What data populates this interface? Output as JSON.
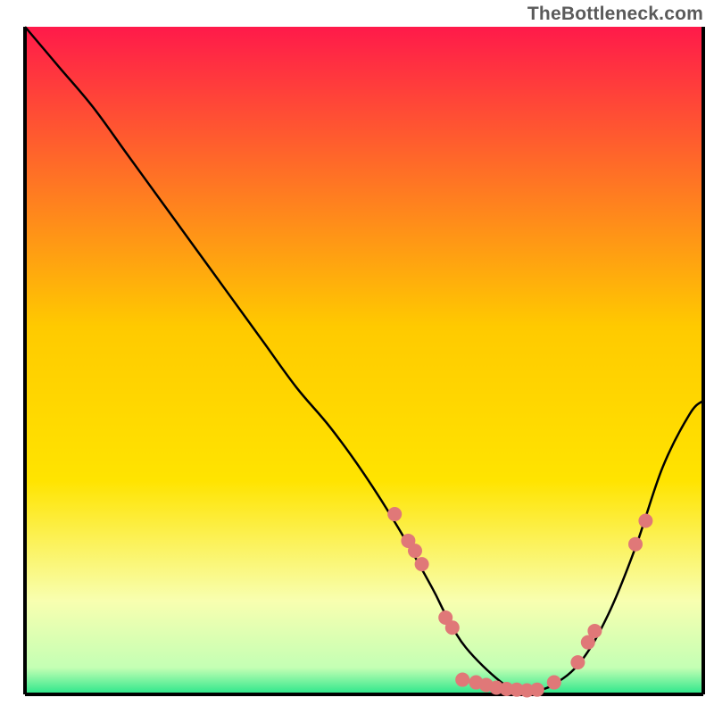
{
  "watermark": "TheBottleneck.com",
  "chart_data": {
    "type": "line",
    "title": "",
    "xlabel": "",
    "ylabel": "",
    "xlim": [
      0,
      100
    ],
    "ylim": [
      0,
      100
    ],
    "grid": false,
    "legend": false,
    "background_gradient_top": "#ff1a4a",
    "background_gradient_mid": "#ffe400",
    "background_gradient_low": "#f8ffb0",
    "background_gradient_bottom": "#29e68a",
    "series": [
      {
        "name": "curve",
        "color": "#000000",
        "x": [
          0,
          5,
          10,
          15,
          20,
          25,
          30,
          35,
          40,
          45,
          50,
          55,
          60,
          62,
          65,
          70,
          73,
          75,
          78,
          82,
          86,
          90,
          94,
          98,
          100
        ],
        "y": [
          100,
          94,
          88,
          81,
          74,
          67,
          60,
          53,
          46,
          40,
          33,
          25,
          16,
          12,
          7,
          2,
          0.5,
          0.5,
          1.5,
          5,
          12,
          22,
          34,
          42,
          44
        ]
      }
    ],
    "markers": [
      {
        "x": 54.5,
        "y": 27
      },
      {
        "x": 56.5,
        "y": 23
      },
      {
        "x": 57.5,
        "y": 21.5
      },
      {
        "x": 58.5,
        "y": 19.5
      },
      {
        "x": 62.0,
        "y": 11.5
      },
      {
        "x": 63.0,
        "y": 10
      },
      {
        "x": 64.5,
        "y": 2.2
      },
      {
        "x": 66.5,
        "y": 1.8
      },
      {
        "x": 68.0,
        "y": 1.4
      },
      {
        "x": 69.5,
        "y": 1.0
      },
      {
        "x": 71.0,
        "y": 0.8
      },
      {
        "x": 72.5,
        "y": 0.7
      },
      {
        "x": 74.0,
        "y": 0.6
      },
      {
        "x": 75.5,
        "y": 0.7
      },
      {
        "x": 78.0,
        "y": 1.8
      },
      {
        "x": 81.5,
        "y": 4.8
      },
      {
        "x": 83.0,
        "y": 7.8
      },
      {
        "x": 84.0,
        "y": 9.5
      },
      {
        "x": 90.0,
        "y": 22.5
      },
      {
        "x": 91.5,
        "y": 26
      }
    ],
    "marker_color": "#e07878",
    "marker_radius": 8
  }
}
